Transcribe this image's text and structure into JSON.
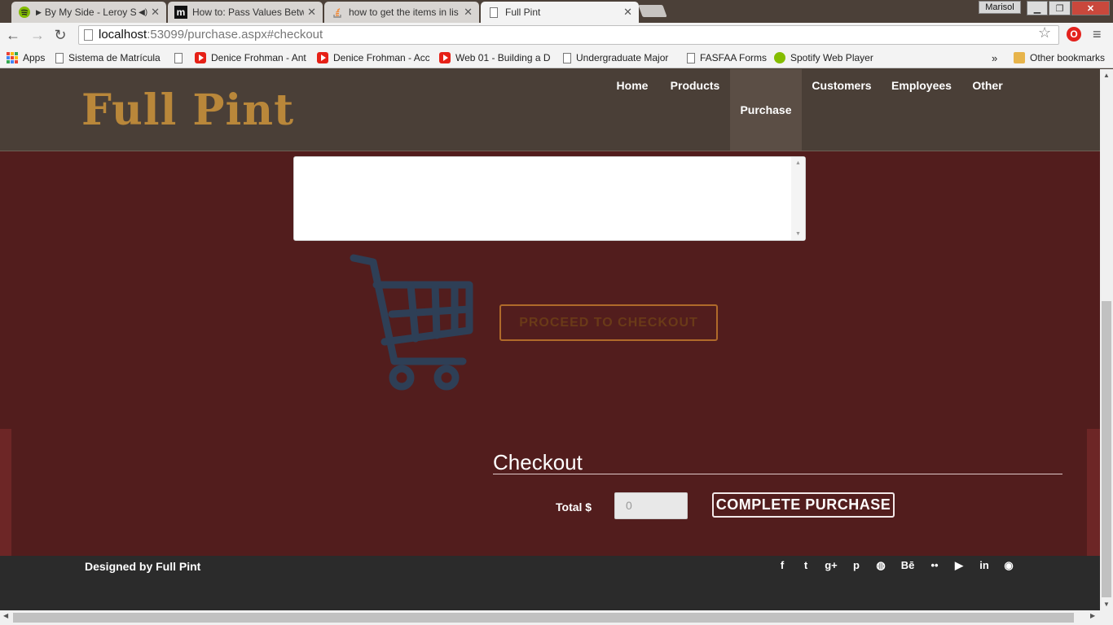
{
  "browser": {
    "tabs": [
      {
        "label": "By My Side - Leroy S",
        "icon": "spotify-icon"
      },
      {
        "label": "How to: Pass Values Betw",
        "icon": "m-icon"
      },
      {
        "label": "how to get the items in lis",
        "icon": "stackoverflow-icon"
      },
      {
        "label": "Full Pint",
        "icon": "page-icon"
      }
    ],
    "close_glyph": "✕",
    "window_user": "Marisol",
    "url_host": "localhost",
    "url_rest": ":53099/purchase.aspx#checkout",
    "bookmarks": [
      {
        "label": "Apps",
        "icon": "apps-icon"
      },
      {
        "label": "Sistema de Matrícula",
        "icon": "page-icon"
      },
      {
        "label": "",
        "icon": "page-icon"
      },
      {
        "label": "Denice Frohman - Ant",
        "icon": "youtube-icon"
      },
      {
        "label": "Denice Frohman - Acc",
        "icon": "youtube-icon"
      },
      {
        "label": "Web 01 - Building a D",
        "icon": "youtube-icon"
      },
      {
        "label": "Undergraduate Major",
        "icon": "page-icon"
      },
      {
        "label": "FASFAA Forms",
        "icon": "page-icon"
      },
      {
        "label": "Spotify Web Player",
        "icon": "spotify-icon"
      }
    ],
    "overflow": "»",
    "other_bookmarks": "Other bookmarks"
  },
  "site": {
    "logo": "Full Pint",
    "nav": [
      "Home",
      "Products",
      "Purchase",
      "Customers",
      "Employees",
      "Other"
    ],
    "active_nav": "Purchase",
    "proceed_button": "PROCEED TO CHECKOUT",
    "checkout_heading": "Checkout",
    "total_label": "Total $",
    "total_value": "0",
    "complete_button": "COMPLETE PURCHASE",
    "footer_text": "Designed by Full Pint",
    "social": [
      {
        "icon": "facebook-icon",
        "glyph": "f"
      },
      {
        "icon": "twitter-icon",
        "glyph": "t"
      },
      {
        "icon": "google-plus-icon",
        "glyph": "g+"
      },
      {
        "icon": "pinterest-icon",
        "glyph": "p"
      },
      {
        "icon": "dribbble-icon",
        "glyph": "◍"
      },
      {
        "icon": "behance-icon",
        "glyph": "Bē"
      },
      {
        "icon": "flickr-icon",
        "glyph": "••"
      },
      {
        "icon": "youtube-icon",
        "glyph": "▶"
      },
      {
        "icon": "linkedin-icon",
        "glyph": "in"
      },
      {
        "icon": "github-icon",
        "glyph": "◉"
      }
    ]
  },
  "colors": {
    "header": "#4a3f37",
    "main": "#521d1d",
    "footer": "#2b2b2b",
    "logo": "#b9873a",
    "cart": "#2e3f56"
  }
}
